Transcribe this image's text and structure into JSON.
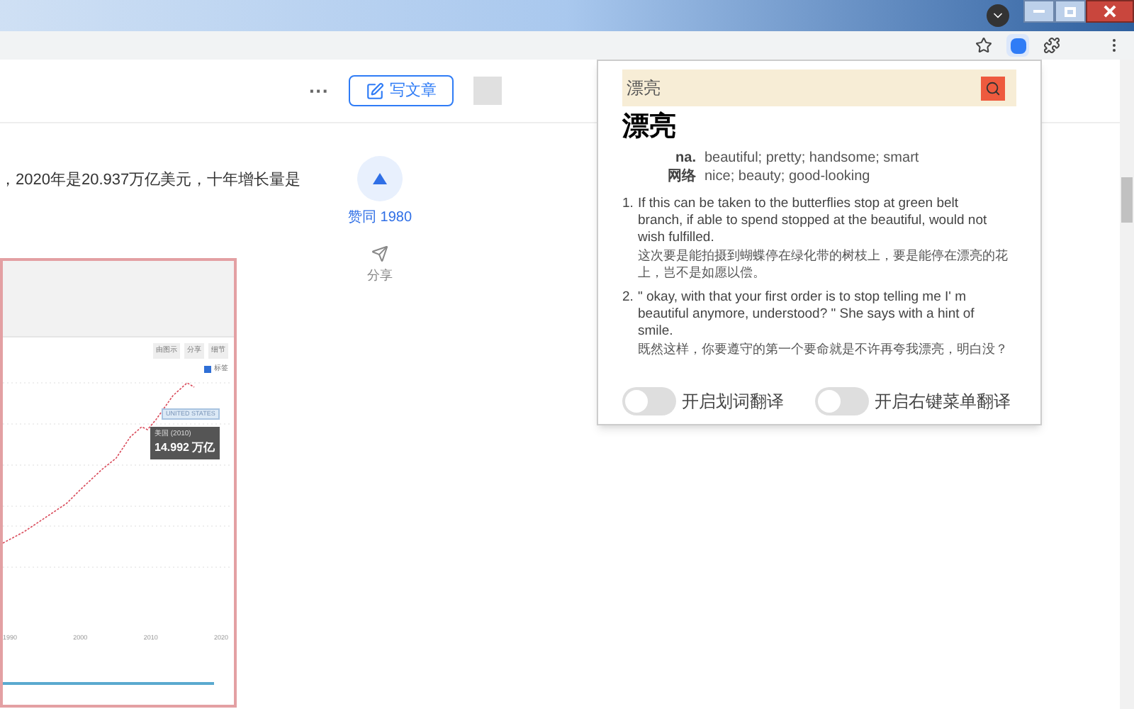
{
  "page": {
    "header": {
      "more": "···",
      "write_button": "写文章"
    },
    "article_text": "，2020年是20.937万亿美元，十年增长量是",
    "vote": {
      "label": "赞同 1980"
    },
    "share": {
      "label": "分享"
    },
    "chart_image": {
      "toolbar": [
        "由图示",
        "分享",
        "细节"
      ],
      "legend": {
        "label": "标签",
        "checked": true
      },
      "series_label": "UNITED STATES",
      "tooltip": {
        "title": "美国 (2010)",
        "value": "14.992 万亿"
      },
      "x_labels": [
        "1990",
        "2000",
        "2010",
        "2020"
      ]
    }
  },
  "popup": {
    "search": {
      "value": "漂亮"
    },
    "headword": "漂亮",
    "senses": [
      {
        "pos": "na.",
        "text": "beautiful; pretty; handsome; smart"
      },
      {
        "pos": "网络",
        "text": "nice; beauty; good-looking"
      }
    ],
    "examples": [
      {
        "number": "1.",
        "en": "If this can be taken to the butterflies stop at green belt branch, if able to spend stopped at the beautiful, would not wish fulfilled.",
        "zh": "这次要是能拍摄到蝴蝶停在绿化带的树枝上，要是能停在漂亮的花上，岂不是如愿以偿。"
      },
      {
        "number": "2.",
        "en": "\" okay, with that your first order is to stop telling me I' m beautiful anymore, understood? \" She says with a hint of smile.",
        "zh": "既然这样，你要遵守的第一个要命就是不许再夸我漂亮，明白没？"
      }
    ],
    "toggles": [
      {
        "label": "开启划词翻译",
        "on": false
      },
      {
        "label": "开启右键菜单翻译",
        "on": false
      }
    ]
  }
}
